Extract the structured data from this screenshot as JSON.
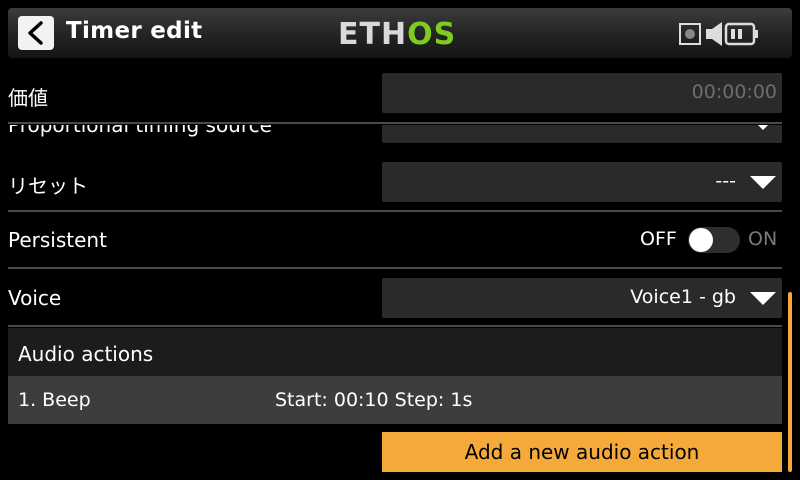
{
  "header": {
    "title": "Timer edit",
    "brand_part1": "ETH",
    "brand_part2": "OS",
    "icons": [
      "back-arrow-icon",
      "sd-card-icon",
      "speaker-icon",
      "battery-icon"
    ]
  },
  "rows": {
    "value_label": "価値",
    "value_field": "00:00:00",
    "prop_label": "Proportional timing source",
    "prop_value": "---",
    "reset_label": "リセット",
    "reset_value": "---",
    "persistent_label": "Persistent",
    "toggle_off": "OFF",
    "toggle_on": "ON",
    "voice_label": "Voice",
    "voice_value": "Voice1 - gb"
  },
  "audio": {
    "header": "Audio actions",
    "items": [
      {
        "name": "1. Beep",
        "detail": "Start: 00:10 Step: 1s"
      }
    ],
    "add_button": "Add a new audio action"
  },
  "colors": {
    "accent": "#f5a93a",
    "brand_green": "#7fcc1f",
    "field_bg": "#2a2a2a"
  }
}
